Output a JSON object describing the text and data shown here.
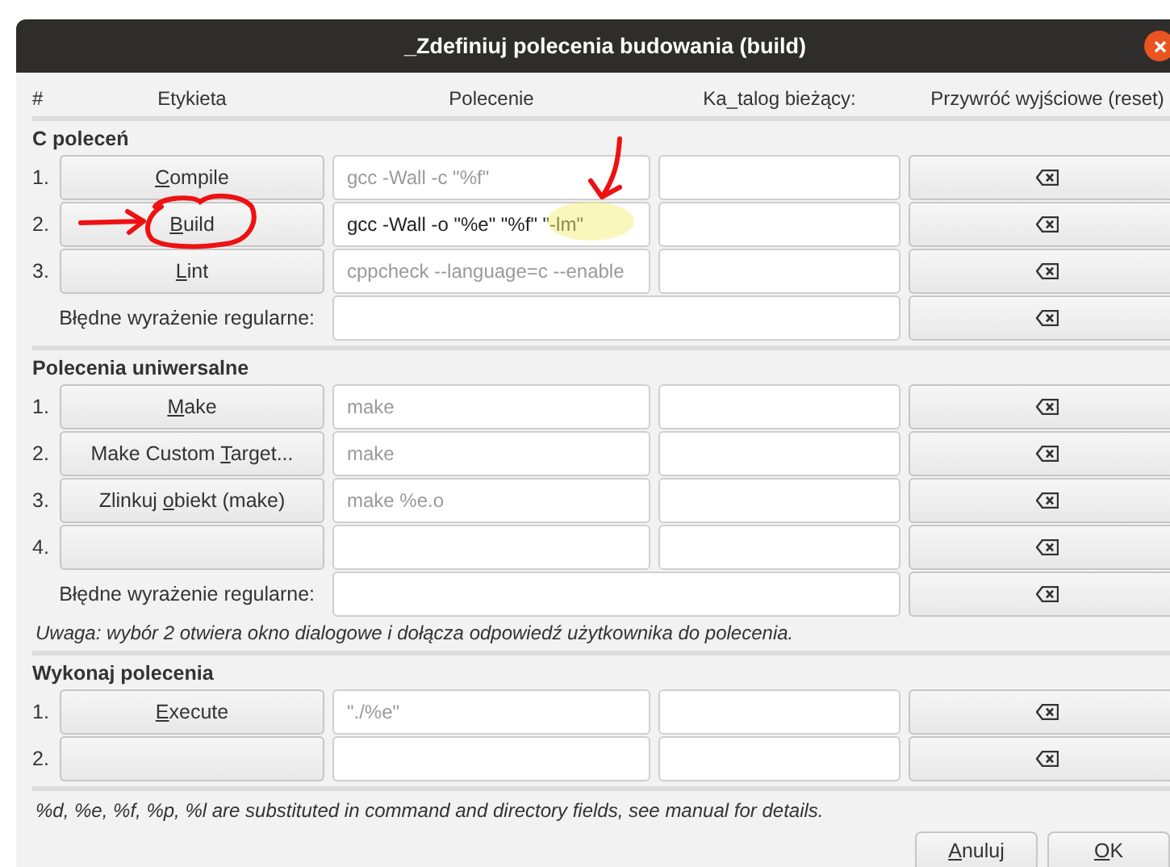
{
  "window": {
    "title": "_Zdefiniuj polecenia budowania (build)"
  },
  "columns": [
    "#",
    "Etykieta",
    "Polecenie",
    "Ka_talog bieżący:",
    "Przywróć wyjściowe (reset)"
  ],
  "sections": [
    {
      "title": "C poleceń",
      "rows": [
        {
          "kind": "command",
          "number": "1.",
          "label": {
            "key": "C",
            "post": "ompile"
          },
          "command": {
            "placeholder": "gcc -Wall -c \"%f\""
          }
        },
        {
          "kind": "command",
          "number": "2.",
          "label": {
            "key": "B",
            "post": "uild"
          },
          "command": {
            "value": "gcc -Wall -o \"%e\" \"%f\" \"-lm\""
          }
        },
        {
          "kind": "command",
          "number": "3.",
          "label": {
            "key": "L",
            "post": "int"
          },
          "command": {
            "placeholder": "cppcheck --language=c --enable"
          }
        },
        {
          "kind": "regex",
          "label": "Błędne wyrażenie regularne:"
        }
      ]
    },
    {
      "title": "Polecenia uniwersalne",
      "rows": [
        {
          "kind": "command",
          "number": "1.",
          "label": {
            "key": "M",
            "post": "ake"
          },
          "command": {
            "placeholder": "make"
          }
        },
        {
          "kind": "command",
          "number": "2.",
          "label": {
            "pre": "Make Custom ",
            "key": "T",
            "post": "arget..."
          },
          "command": {
            "placeholder": "make"
          }
        },
        {
          "kind": "command",
          "number": "3.",
          "label": {
            "pre": "Zlinkuj ",
            "key": "o",
            "post": "biekt (make)"
          },
          "command": {
            "placeholder": "make %e.o"
          }
        },
        {
          "kind": "command",
          "number": "4."
        },
        {
          "kind": "regex",
          "label": "Błędne wyrażenie regularne:"
        }
      ],
      "note": "Uwaga: wybór 2 otwiera okno dialogowe i dołącza odpowiedź użytkownika do polecenia."
    },
    {
      "title": "Wykonaj polecenia",
      "rows": [
        {
          "kind": "command",
          "number": "1.",
          "label": {
            "key": "E",
            "post": "xecute"
          },
          "command": {
            "placeholder": "\"./%e\""
          }
        },
        {
          "kind": "command",
          "number": "2."
        }
      ]
    }
  ],
  "footnote": "%d, %e, %f, %p, %l are substituted in command and directory fields, see manual for details.",
  "buttons": [
    {
      "label": {
        "key": "A",
        "post": "nuluj"
      }
    },
    {
      "label": {
        "key": "O",
        "post": "K"
      }
    }
  ]
}
